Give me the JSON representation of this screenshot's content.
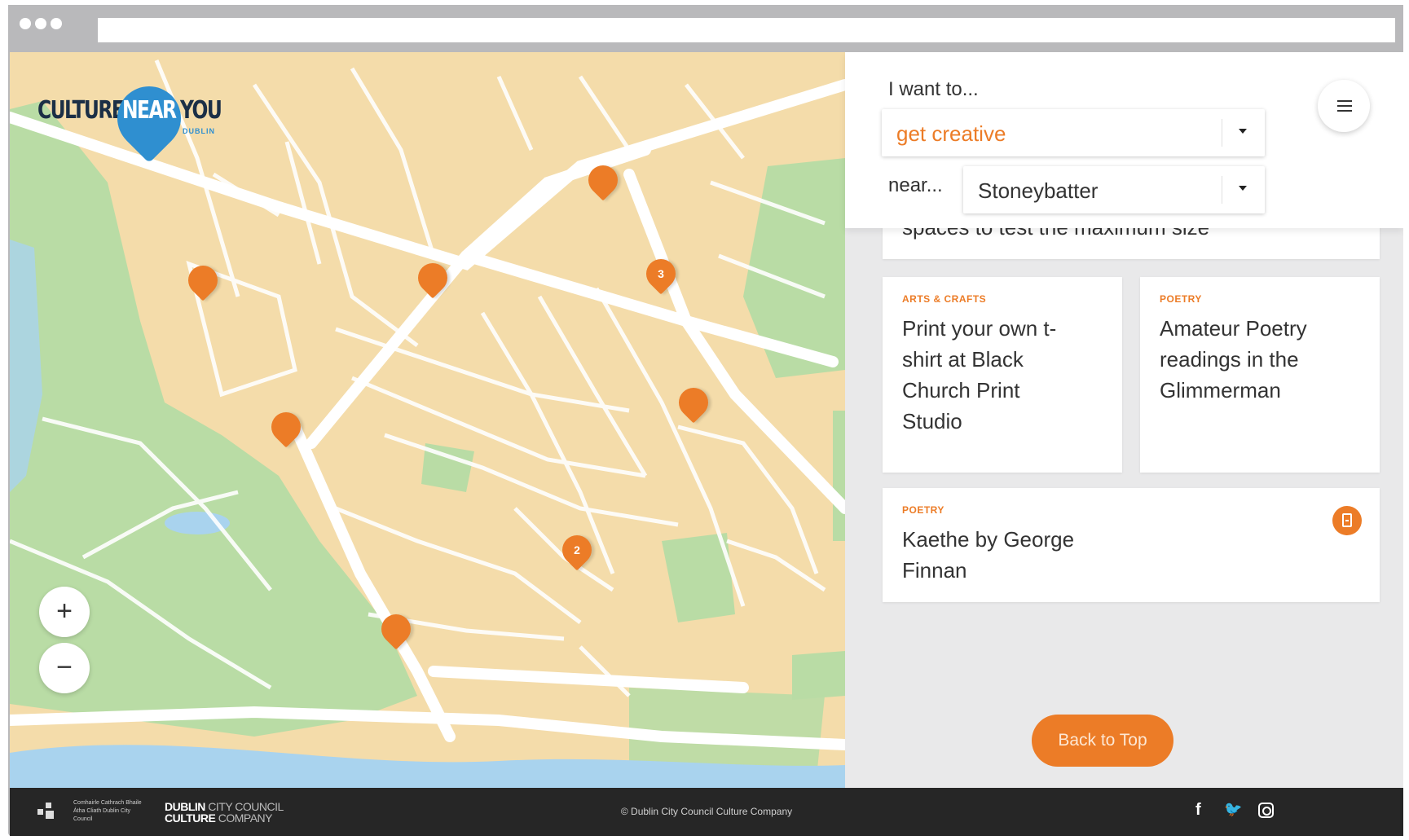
{
  "app": {
    "logo_text_left": "CULTURE",
    "logo_text_badge": "NEAR",
    "logo_text_right": "YOU",
    "logo_subtext": "DUBLIN"
  },
  "filter": {
    "want_label": "I want to...",
    "want_value": "get creative",
    "near_label": "near...",
    "near_value": "Stoneybatter"
  },
  "map": {
    "pins": [
      {
        "label": ""
      },
      {
        "label": ""
      },
      {
        "label": "3"
      },
      {
        "label": ""
      },
      {
        "label": ""
      },
      {
        "label": ""
      },
      {
        "label": "2"
      },
      {
        "label": ""
      }
    ],
    "zoom_in": "+",
    "zoom_out": "−"
  },
  "cards": [
    {
      "category": "",
      "title": "spaces to test the maximum size"
    },
    {
      "category": "ARTS & CRAFTS",
      "title": "Print your own t-shirt at Black Church Print Studio"
    },
    {
      "category": "POETRY",
      "title": "Amateur Poetry readings in the Glimmerman"
    },
    {
      "category": "POETRY",
      "title": "Kaethe by George Finnan"
    }
  ],
  "back_to_top": "Back to Top",
  "footer": {
    "ga_text": "Comhairle Cathrach Bhaile Átha Cliath Dublin City Council",
    "dcc_line1_bold": "DUBLIN",
    "dcc_line1_thin": "CITY COUNCIL",
    "dcc_line2_bold": "CULTURE",
    "dcc_line2_thin": "COMPANY",
    "copyright": "© Dublin City Council Culture Company",
    "social": {
      "facebook": "f",
      "twitter": "🐦"
    }
  },
  "colors": {
    "accent": "#ec7c27",
    "map_land": "#f4dcaa",
    "map_park": "#b9dca5",
    "map_water": "#a9d3ee",
    "logo_blue": "#2f8fd0"
  }
}
